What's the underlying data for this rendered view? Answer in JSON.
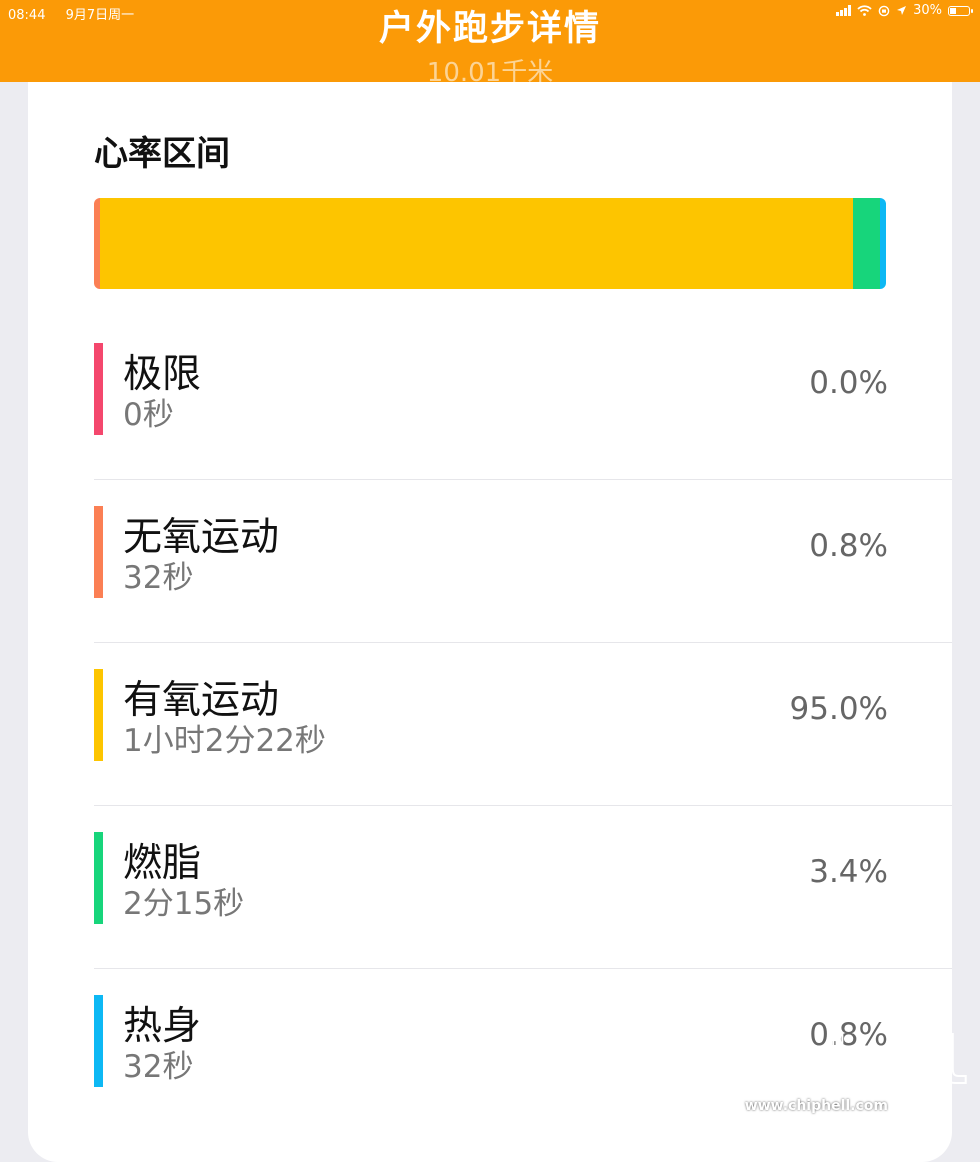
{
  "status_bar": {
    "time": "08:44",
    "date": "9月7日周一",
    "battery": "30%",
    "icons": [
      "signal-icon",
      "wifi-icon",
      "lock-rotation-icon",
      "location-icon",
      "battery-icon"
    ]
  },
  "nav": {
    "title": "户外跑步详情",
    "subtitle": "10.01千米"
  },
  "colors": {
    "accent": "#fb9a07",
    "extreme": "#f4476d",
    "anaerobic": "#fb7f54",
    "aerobic": "#fdc500",
    "fatburn": "#17d57b",
    "warmup": "#0db8f4"
  },
  "heart_rate": {
    "title": "心率区间",
    "zones": [
      {
        "name": "极限",
        "duration": "0秒",
        "percent": "0.0%",
        "share": 0.0,
        "color": "#f4476d"
      },
      {
        "name": "无氧运动",
        "duration": "32秒",
        "percent": "0.8%",
        "share": 0.8,
        "color": "#fb7f54"
      },
      {
        "name": "有氧运动",
        "duration": "1小时2分22秒",
        "percent": "95.0%",
        "share": 95.0,
        "color": "#fdc500"
      },
      {
        "name": "燃脂",
        "duration": "2分15秒",
        "percent": "3.4%",
        "share": 3.4,
        "color": "#17d57b"
      },
      {
        "name": "热身",
        "duration": "32秒",
        "percent": "0.8%",
        "share": 0.8,
        "color": "#0db8f4"
      }
    ]
  },
  "watermark": {
    "logo": "chiphell",
    "url": "www.chiphell.com"
  }
}
